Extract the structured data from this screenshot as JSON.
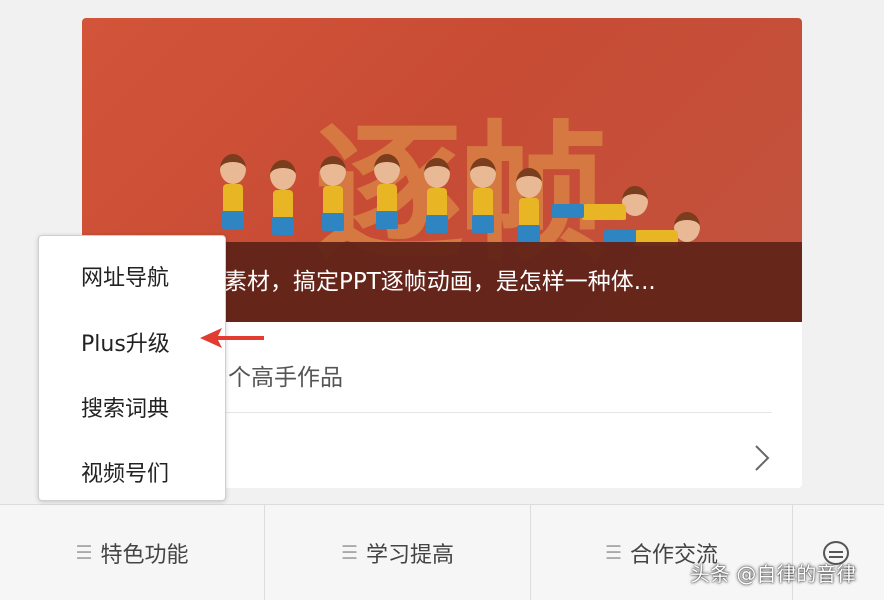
{
  "article": {
    "banner_word": "逐帧",
    "caption": "素材，搞定PPT逐帧动画，是怎样一种体...",
    "subtitle": "个高手作品"
  },
  "popup_menu": {
    "items": [
      "网址导航",
      "Plus升级",
      "搜索词典",
      "视频号们"
    ]
  },
  "bottom_bar": {
    "items": [
      "特色功能",
      "学习提高",
      "合作交流"
    ]
  },
  "watermark": "头条 @自律的音律",
  "colors": {
    "banner": "#c84b34",
    "caption_bar": "#5f2218",
    "arrow": "#e23b2f"
  }
}
